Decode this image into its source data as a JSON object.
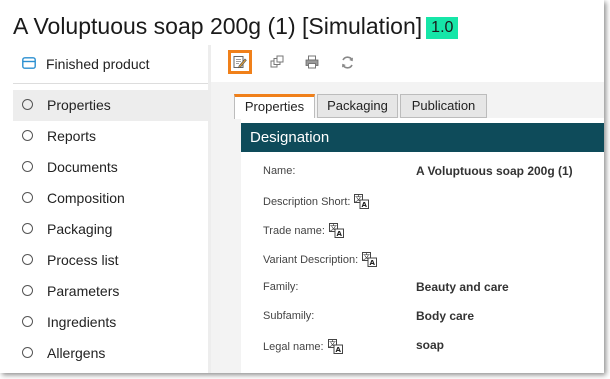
{
  "header": {
    "title": "A Voluptuous soap 200g (1) [Simulation]",
    "version": "1.0",
    "version_color": "#16e6a8"
  },
  "sidebar": {
    "header_label": "Finished product",
    "header_icon": "product-card-icon",
    "items": [
      {
        "label": "Properties",
        "active": true
      },
      {
        "label": "Reports"
      },
      {
        "label": "Documents"
      },
      {
        "label": "Composition"
      },
      {
        "label": "Packaging"
      },
      {
        "label": "Process list"
      },
      {
        "label": "Parameters"
      },
      {
        "label": "Ingredients"
      },
      {
        "label": "Allergens"
      }
    ]
  },
  "toolbar": {
    "buttons": [
      {
        "icon": "edit-icon",
        "highlighted": true
      },
      {
        "icon": "copy-icon"
      },
      {
        "icon": "print-icon"
      },
      {
        "icon": "refresh-icon"
      }
    ],
    "highlight_color": "#f0801a"
  },
  "tabs": [
    {
      "label": "Properties",
      "active": true
    },
    {
      "label": "Packaging"
    },
    {
      "label": "Publication"
    }
  ],
  "section": {
    "title": "Designation",
    "color": "#0e4b5a"
  },
  "fields": [
    {
      "label": "Name:",
      "value": "A Voluptuous soap 200g (1)",
      "translatable": false
    },
    {
      "label": "Description Short:",
      "value": "",
      "translatable": true
    },
    {
      "label": "Trade name:",
      "value": "",
      "translatable": true
    },
    {
      "label": "Variant Description:",
      "value": "",
      "translatable": true
    },
    {
      "label": "Family:",
      "value": "Beauty and care",
      "translatable": false
    },
    {
      "label": "Subfamily:",
      "value": "Body care",
      "translatable": false
    },
    {
      "label": "Legal name:",
      "value": "soap",
      "translatable": true
    }
  ]
}
